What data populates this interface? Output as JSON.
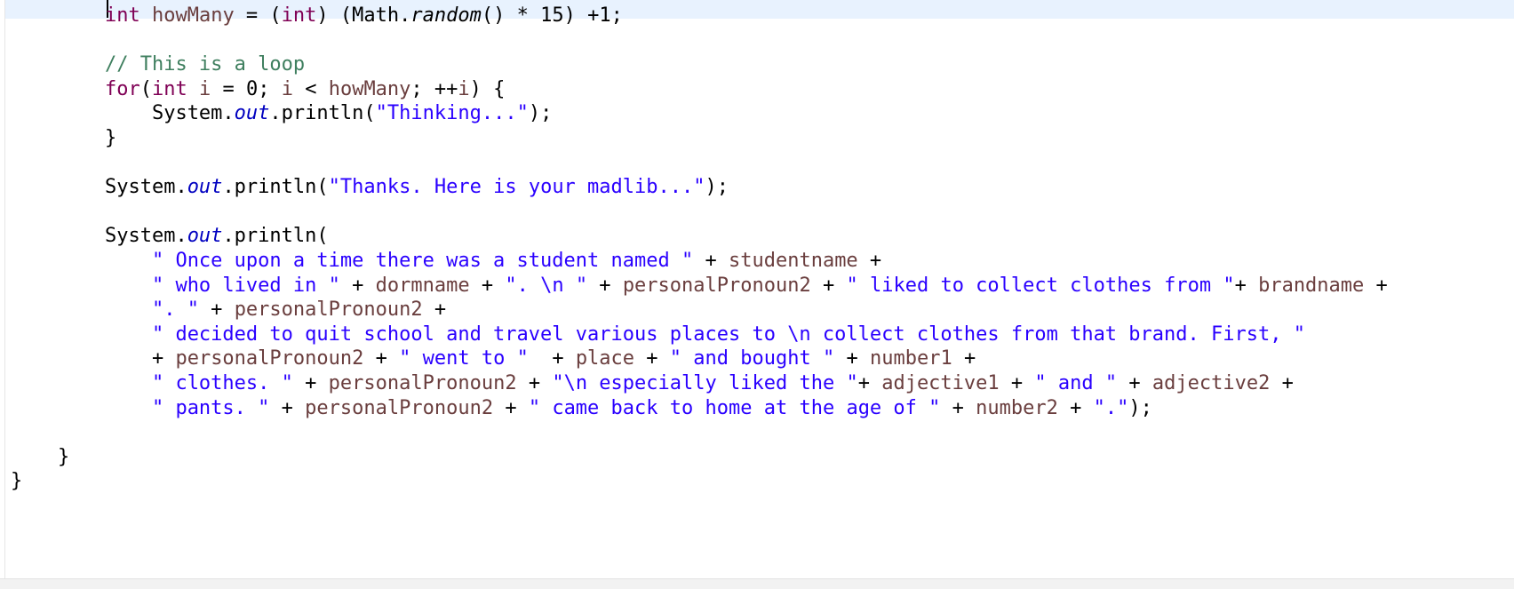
{
  "editor": {
    "lines": [
      {
        "indent": "        ",
        "tokens": [
          {
            "t": "int",
            "c": "kw"
          },
          {
            "t": " ",
            "c": ""
          },
          {
            "t": "howMany",
            "c": "var"
          },
          {
            "t": " = (",
            "c": ""
          },
          {
            "t": "int",
            "c": "kw"
          },
          {
            "t": ") (Math.",
            "c": ""
          },
          {
            "t": "random",
            "c": "it"
          },
          {
            "t": "() * 15) +1;",
            "c": ""
          }
        ]
      },
      {
        "indent": "",
        "tokens": []
      },
      {
        "indent": "        ",
        "tokens": [
          {
            "t": "// This is a loop",
            "c": "com"
          }
        ]
      },
      {
        "indent": "        ",
        "tokens": [
          {
            "t": "for",
            "c": "kw"
          },
          {
            "t": "(",
            "c": ""
          },
          {
            "t": "int",
            "c": "kw"
          },
          {
            "t": " ",
            "c": ""
          },
          {
            "t": "i",
            "c": "var"
          },
          {
            "t": " = 0; ",
            "c": ""
          },
          {
            "t": "i",
            "c": "var"
          },
          {
            "t": " < ",
            "c": ""
          },
          {
            "t": "howMany",
            "c": "var"
          },
          {
            "t": "; ++",
            "c": ""
          },
          {
            "t": "i",
            "c": "var"
          },
          {
            "t": ") {",
            "c": ""
          }
        ]
      },
      {
        "indent": "            ",
        "tokens": [
          {
            "t": "System.",
            "c": ""
          },
          {
            "t": "out",
            "c": "fld"
          },
          {
            "t": ".println(",
            "c": ""
          },
          {
            "t": "\"Thinking...\"",
            "c": "str"
          },
          {
            "t": ");",
            "c": ""
          }
        ]
      },
      {
        "indent": "        ",
        "tokens": [
          {
            "t": "}",
            "c": ""
          }
        ]
      },
      {
        "indent": "",
        "tokens": []
      },
      {
        "indent": "        ",
        "tokens": [
          {
            "t": "System.",
            "c": ""
          },
          {
            "t": "out",
            "c": "fld"
          },
          {
            "t": ".println(",
            "c": ""
          },
          {
            "t": "\"Thanks. Here is your madlib...\"",
            "c": "str"
          },
          {
            "t": ");",
            "c": ""
          }
        ]
      },
      {
        "indent": "",
        "tokens": []
      },
      {
        "indent": "        ",
        "tokens": [
          {
            "t": "System.",
            "c": ""
          },
          {
            "t": "out",
            "c": "fld"
          },
          {
            "t": ".println(",
            "c": ""
          }
        ]
      },
      {
        "indent": "            ",
        "tokens": [
          {
            "t": "\" Once upon a time there was a student named \"",
            "c": "str"
          },
          {
            "t": " + ",
            "c": ""
          },
          {
            "t": "studentname",
            "c": "var"
          },
          {
            "t": " +",
            "c": ""
          }
        ]
      },
      {
        "indent": "            ",
        "tokens": [
          {
            "t": "\" who lived in \"",
            "c": "str"
          },
          {
            "t": " + ",
            "c": ""
          },
          {
            "t": "dormname",
            "c": "var"
          },
          {
            "t": " + ",
            "c": ""
          },
          {
            "t": "\". \\n \"",
            "c": "str"
          },
          {
            "t": " + ",
            "c": ""
          },
          {
            "t": "personalPronoun2",
            "c": "var"
          },
          {
            "t": " + ",
            "c": ""
          },
          {
            "t": "\" liked to collect clothes from \"",
            "c": "str"
          },
          {
            "t": "+ ",
            "c": ""
          },
          {
            "t": "brandname",
            "c": "var"
          },
          {
            "t": " +",
            "c": ""
          }
        ]
      },
      {
        "indent": "            ",
        "tokens": [
          {
            "t": "\". \"",
            "c": "str"
          },
          {
            "t": " + ",
            "c": ""
          },
          {
            "t": "personalPronoun2",
            "c": "var"
          },
          {
            "t": " +",
            "c": ""
          }
        ]
      },
      {
        "indent": "            ",
        "tokens": [
          {
            "t": "\" decided to quit school and travel various places to \\n collect clothes from that brand. First, \"",
            "c": "str"
          }
        ]
      },
      {
        "indent": "            ",
        "tokens": [
          {
            "t": "+ ",
            "c": ""
          },
          {
            "t": "personalPronoun2",
            "c": "var"
          },
          {
            "t": " + ",
            "c": ""
          },
          {
            "t": "\" went to \"",
            "c": "str"
          },
          {
            "t": "  + ",
            "c": ""
          },
          {
            "t": "place",
            "c": "var"
          },
          {
            "t": " + ",
            "c": ""
          },
          {
            "t": "\" and bought \"",
            "c": "str"
          },
          {
            "t": " + ",
            "c": ""
          },
          {
            "t": "number1",
            "c": "var"
          },
          {
            "t": " +",
            "c": ""
          }
        ]
      },
      {
        "indent": "            ",
        "tokens": [
          {
            "t": "\" clothes. \"",
            "c": "str"
          },
          {
            "t": " + ",
            "c": ""
          },
          {
            "t": "personalPronoun2",
            "c": "var"
          },
          {
            "t": " + ",
            "c": ""
          },
          {
            "t": "\"\\n especially liked the \"",
            "c": "str"
          },
          {
            "t": "+ ",
            "c": ""
          },
          {
            "t": "adjective1",
            "c": "var"
          },
          {
            "t": " + ",
            "c": ""
          },
          {
            "t": "\" and \"",
            "c": "str"
          },
          {
            "t": " + ",
            "c": ""
          },
          {
            "t": "adjective2",
            "c": "var"
          },
          {
            "t": " +",
            "c": ""
          }
        ]
      },
      {
        "indent": "            ",
        "tokens": [
          {
            "t": "\" pants. \"",
            "c": "str"
          },
          {
            "t": " + ",
            "c": ""
          },
          {
            "t": "personalPronoun2",
            "c": "var"
          },
          {
            "t": " + ",
            "c": ""
          },
          {
            "t": "\" came back to home at the age of \"",
            "c": "str"
          },
          {
            "t": " + ",
            "c": ""
          },
          {
            "t": "number2",
            "c": "var"
          },
          {
            "t": " + ",
            "c": ""
          },
          {
            "t": "\".\"",
            "c": "str"
          },
          {
            "t": ");",
            "c": ""
          }
        ]
      },
      {
        "indent": "",
        "tokens": []
      },
      {
        "indent": "    ",
        "tokens": [
          {
            "t": "}",
            "c": ""
          }
        ]
      },
      {
        "indent": "",
        "tokens": [
          {
            "t": "}",
            "c": ""
          }
        ]
      }
    ]
  }
}
